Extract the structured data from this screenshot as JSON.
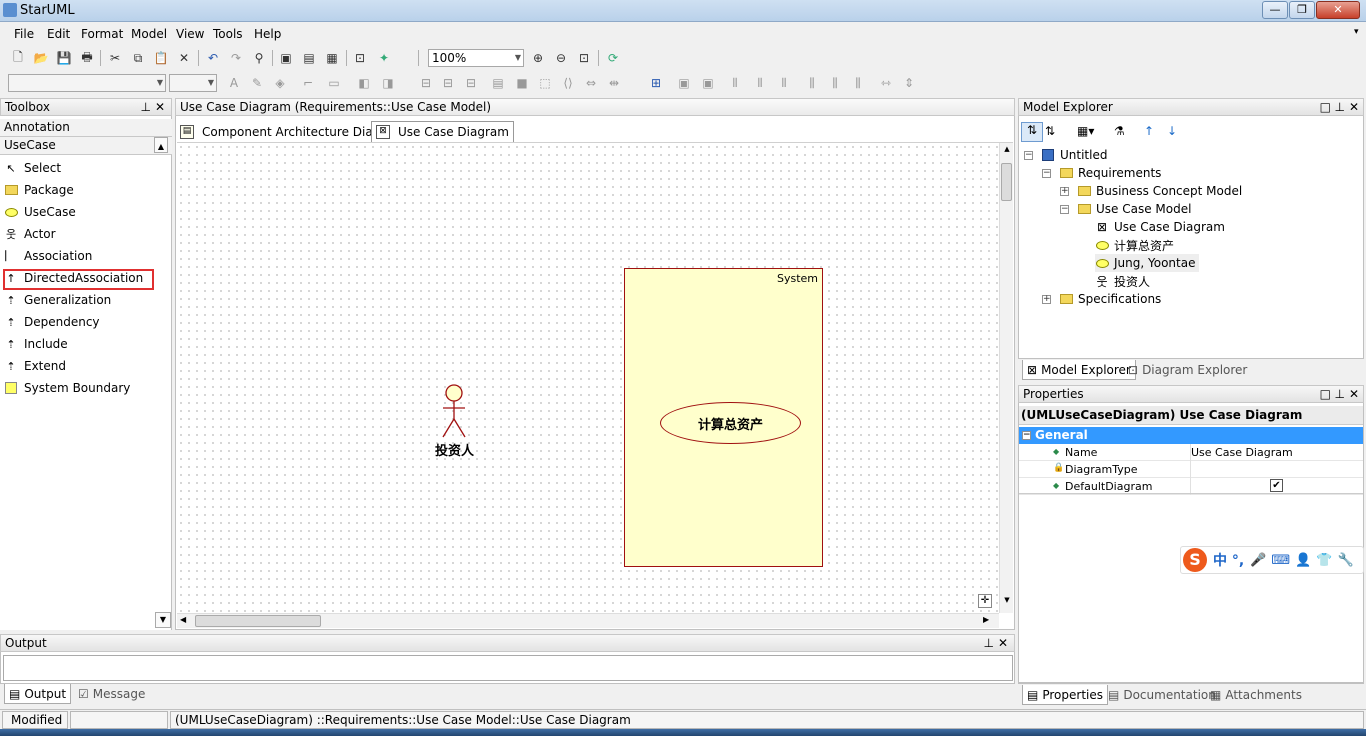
{
  "window": {
    "title": "StarUML",
    "minimize": "—",
    "maximize": "❐",
    "close": "✕"
  },
  "menu": [
    "File",
    "Edit",
    "Format",
    "Model",
    "View",
    "Tools",
    "Help"
  ],
  "toolbar": {
    "zoom": "100%"
  },
  "toolbox": {
    "title": "Toolbox",
    "section_annotation": "Annotation",
    "section_usecase": "UseCase",
    "items": [
      "Select",
      "Package",
      "UseCase",
      "Actor",
      "Association",
      "DirectedAssociation",
      "Generalization",
      "Dependency",
      "Include",
      "Extend",
      "System Boundary"
    ],
    "highlighted": "DirectedAssociation"
  },
  "diagram": {
    "header": "Use Case Diagram (Requirements::Use Case Model)",
    "tabs": [
      "Component Architecture Diagram",
      "Use Case Diagram"
    ],
    "active_tab": "Use Case Diagram",
    "actor_label": "投资人",
    "system_label": "System",
    "usecase_label": "计算总资产"
  },
  "model_explorer": {
    "title": "Model Explorer",
    "tree": {
      "root": "Untitled",
      "requirements": "Requirements",
      "bcm": "Business Concept Model",
      "ucm": "Use Case Model",
      "ucd": "Use Case Diagram",
      "uc": "计算总资产",
      "jung": "Jung, Yoontae",
      "actor": "投资人",
      "spec": "Specifications"
    },
    "tabs": [
      "Model Explorer",
      "Diagram Explorer"
    ]
  },
  "properties": {
    "title": "Properties",
    "object": "(UMLUseCaseDiagram) Use Case Diagram",
    "group": "General",
    "rows": [
      {
        "name": "Name",
        "value": "Use Case Diagram"
      },
      {
        "name": "DiagramType",
        "value": ""
      },
      {
        "name": "DefaultDiagram",
        "value": "✔"
      }
    ],
    "tabs": [
      "Properties",
      "Documentation",
      "Attachments"
    ]
  },
  "ime": {
    "logo": "S",
    "chars": "中 °,"
  },
  "output": {
    "title": "Output",
    "tabs": [
      "Output",
      "Message"
    ]
  },
  "status": {
    "state": "Modified",
    "path": "(UMLUseCaseDiagram) ::Requirements::Use Case Model::Use Case Diagram"
  },
  "colors": {
    "highlight_box": "#e03030",
    "usecase_fill": "#ffffcc",
    "selection": "#3399ff"
  }
}
